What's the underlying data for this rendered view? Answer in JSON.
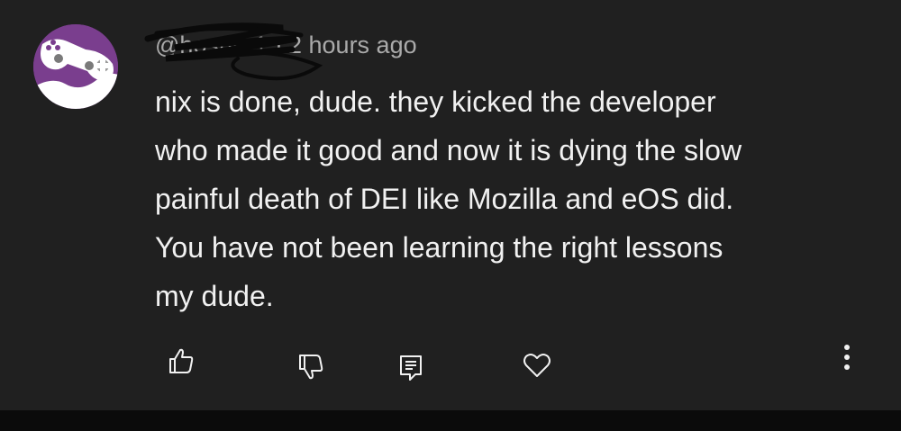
{
  "comment": {
    "handle_prefix": "@",
    "handle": "hosnur1",
    "separator": "·",
    "timestamp": "2 hours ago",
    "lines": [
      "nix is done, dude. they kicked the developer",
      "who made it good and now it is dying the slow",
      "painful death of DEI like Mozilla and eOS did.",
      "You have not been learning the right lessons",
      "my dude."
    ]
  },
  "actions": {
    "like_icon": "thumbs-up-icon",
    "dislike_icon": "thumbs-down-icon",
    "reply_icon": "reply-comment-icon",
    "heart_icon": "heart-icon",
    "more_icon": "more-vert-icon"
  },
  "colors": {
    "background": "#202020",
    "text": "#f1f1f1",
    "meta_text": "#aaaaaa",
    "avatar_bg": "#7a3e8e",
    "avatar_controller": "#ffffff"
  }
}
